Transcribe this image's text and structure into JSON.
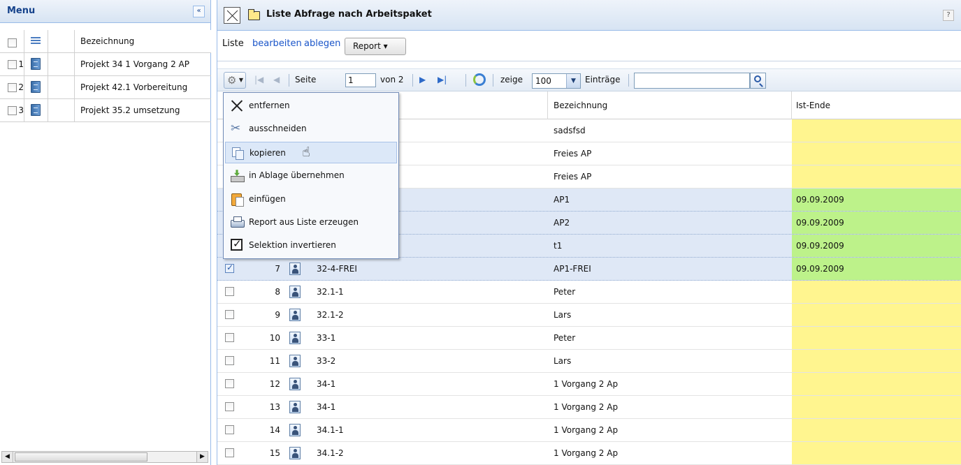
{
  "left_panel": {
    "title": "Menu",
    "collapse_label": "«",
    "header_label": "Bezeichnung",
    "rows": [
      {
        "num": "1",
        "label": "Projekt 34 1 Vorgang 2 AP"
      },
      {
        "num": "2",
        "label": "Projekt 42.1 Vorbereitung"
      },
      {
        "num": "3",
        "label": "Projekt 35.2 umsetzung"
      }
    ]
  },
  "main": {
    "title": "Liste Abfrage nach Arbeitspaket",
    "help_label": "?",
    "actions": {
      "liste_label": "Liste",
      "edit_link": "bearbeiten",
      "store_link": "ablegen",
      "report_button": "Report ▾"
    },
    "toolbar": {
      "page_label": "Seite",
      "page_value": "1",
      "of_label": "von 2",
      "show_label": "zeige",
      "entries_value": "100",
      "entries_label": "Einträge",
      "search_value": ""
    },
    "columns": [
      "Bezeichnung",
      "Ist-Ende"
    ],
    "rows": [
      {
        "num": "",
        "code": "",
        "bez": "sadsfsd",
        "end": "",
        "status": "yellow",
        "selected": false
      },
      {
        "num": "",
        "code": "",
        "bez": "Freies AP",
        "end": "",
        "status": "yellow",
        "selected": false
      },
      {
        "num": "",
        "code": "",
        "bez": "Freies AP",
        "end": "",
        "status": "yellow",
        "selected": false
      },
      {
        "num": "",
        "code": "",
        "bez": "AP1",
        "end": "09.09.2009",
        "status": "green",
        "selected": true
      },
      {
        "num": "",
        "code": "",
        "bez": "AP2",
        "end": "09.09.2009",
        "status": "green",
        "selected": true
      },
      {
        "num": "",
        "code": "",
        "bez": "t1",
        "end": "09.09.2009",
        "status": "green",
        "selected": true
      },
      {
        "num": "7",
        "code": "32-4-FREI",
        "bez": "AP1-FREI",
        "end": "09.09.2009",
        "status": "green",
        "selected": true
      },
      {
        "num": "8",
        "code": "32.1-1",
        "bez": "Peter",
        "end": "",
        "status": "yellow",
        "selected": false
      },
      {
        "num": "9",
        "code": "32.1-2",
        "bez": "Lars",
        "end": "",
        "status": "yellow",
        "selected": false
      },
      {
        "num": "10",
        "code": "33-1",
        "bez": "Peter",
        "end": "",
        "status": "yellow",
        "selected": false
      },
      {
        "num": "11",
        "code": "33-2",
        "bez": "Lars",
        "end": "",
        "status": "yellow",
        "selected": false
      },
      {
        "num": "12",
        "code": "34-1",
        "bez": "1 Vorgang 2 Ap",
        "end": "",
        "status": "yellow",
        "selected": false
      },
      {
        "num": "13",
        "code": "34-1",
        "bez": "1 Vorgang 2 Ap",
        "end": "",
        "status": "yellow",
        "selected": false
      },
      {
        "num": "14",
        "code": "34.1-1",
        "bez": "1 Vorgang 2 Ap",
        "end": "",
        "status": "yellow",
        "selected": false
      },
      {
        "num": "15",
        "code": "34.1-2",
        "bez": "1 Vorgang 2 Ap",
        "end": "",
        "status": "yellow",
        "selected": false
      }
    ]
  },
  "context_menu": {
    "items": [
      {
        "label": "entfernen",
        "icon": "close-icon"
      },
      {
        "label": "ausschneiden",
        "icon": "scissors-icon"
      },
      {
        "label": "kopieren",
        "icon": "copy-icon"
      },
      {
        "label": "in Ablage übernehmen",
        "icon": "tray-icon"
      },
      {
        "label": "einfügen",
        "icon": "paste-icon"
      },
      {
        "label": "Report aus Liste erzeugen",
        "icon": "print-icon"
      },
      {
        "label": "Selektion invertieren",
        "icon": "checkbox-icon"
      }
    ],
    "hover_index": 2
  },
  "colors": {
    "selected_row": "#dfe8f6",
    "status_yellow": "#fff58f",
    "status_green": "#bdf28a",
    "link_blue": "#1a55c9"
  }
}
